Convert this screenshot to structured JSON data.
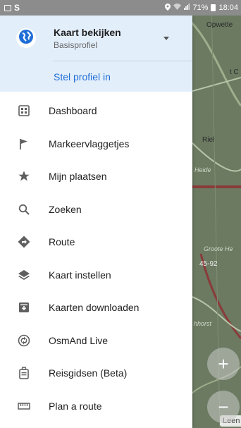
{
  "status_bar": {
    "left_letter": "S",
    "battery_text": "71%",
    "time": "18:04"
  },
  "map": {
    "labels": [
      "Opwette",
      "t C",
      "Riel",
      "Heide",
      "Groote He",
      "45-92",
      "hhorst",
      "Leen"
    ],
    "zoom_in": "+",
    "zoom_out": "−"
  },
  "drawer": {
    "profile": {
      "name": "Kaart bekijken",
      "subtitle": "Basisprofiel",
      "setup_link": "Stel profiel in"
    },
    "menu": [
      {
        "label": "Dashboard",
        "icon": "dashboard-icon"
      },
      {
        "label": "Markeervlaggetjes",
        "icon": "flag-icon"
      },
      {
        "label": "Mijn plaatsen",
        "icon": "star-icon"
      },
      {
        "label": "Zoeken",
        "icon": "search-icon"
      },
      {
        "label": "Route",
        "icon": "route-icon"
      },
      {
        "label": "Kaart instellen",
        "icon": "layers-icon"
      },
      {
        "label": "Kaarten downloaden",
        "icon": "download-icon"
      },
      {
        "label": "OsmAnd Live",
        "icon": "live-update-icon"
      },
      {
        "label": "Reisgidsen (Beta)",
        "icon": "travel-guide-icon"
      },
      {
        "label": "Plan a route",
        "icon": "ruler-icon"
      }
    ]
  },
  "colors": {
    "accent": "#1f6ed6",
    "profile_background": "#e3eefb",
    "icon": "#5f5f5f"
  }
}
